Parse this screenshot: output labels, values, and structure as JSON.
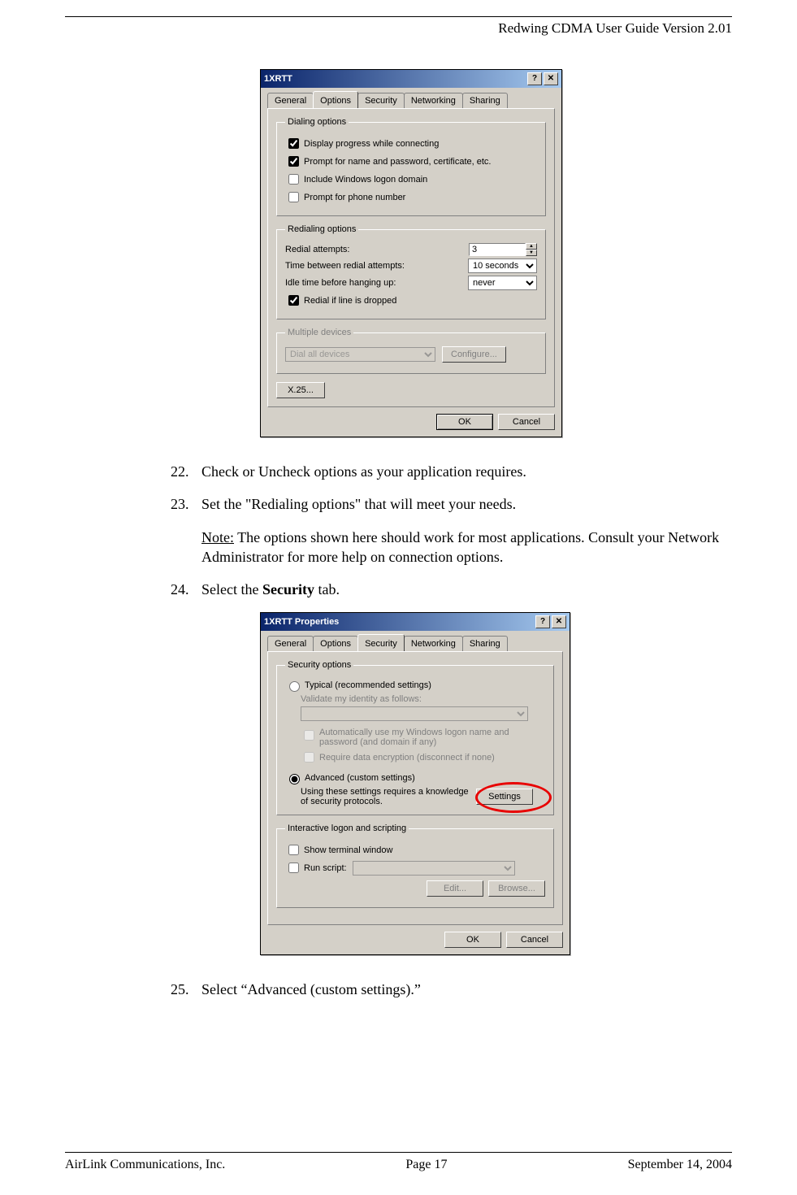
{
  "header": {
    "title": "Redwing CDMA User Guide Version 2.01"
  },
  "dialog1": {
    "title": "1XRTT",
    "help_btn": "?",
    "close_btn": "✕",
    "tabs": [
      "General",
      "Options",
      "Security",
      "Networking",
      "Sharing"
    ],
    "active_tab": 1,
    "dialing_options": {
      "legend": "Dialing options",
      "display_progress": {
        "label": "Display progress while connecting",
        "checked": true
      },
      "prompt_name": {
        "label": "Prompt for name and password, certificate, etc.",
        "checked": true
      },
      "include_domain": {
        "label": "Include Windows logon domain",
        "checked": false
      },
      "prompt_phone": {
        "label": "Prompt for phone number",
        "checked": false
      }
    },
    "redialing_options": {
      "legend": "Redialing options",
      "redial_attempts_label": "Redial attempts:",
      "redial_attempts_value": "3",
      "time_between_label": "Time between redial attempts:",
      "time_between_value": "10 seconds",
      "idle_label": "Idle time before hanging up:",
      "idle_value": "never",
      "redial_dropped": {
        "label": "Redial if line is dropped",
        "checked": true
      }
    },
    "multiple_devices": {
      "legend": "Multiple devices",
      "select_value": "Dial all devices",
      "configure_btn": "Configure..."
    },
    "x25_btn": "X.25...",
    "ok_btn": "OK",
    "cancel_btn": "Cancel"
  },
  "steps": {
    "s22_num": "22.",
    "s22": "Check or Uncheck options as your application requires.",
    "s23_num": "23.",
    "s23": "Set the \"Redialing options\" that will meet your needs.",
    "note_label": "Note:",
    "note_text": " The options shown here should work for most applications. Consult your Network Administrator for more help on connection options.",
    "s24_num": "24.",
    "s24_pre": "Select the ",
    "s24_bold": "Security",
    "s24_post": " tab.",
    "s25_num": "25.",
    "s25": "Select “Advanced (custom settings).”"
  },
  "dialog2": {
    "title": "1XRTT Properties",
    "help_btn": "?",
    "close_btn": "✕",
    "tabs": [
      "General",
      "Options",
      "Security",
      "Networking",
      "Sharing"
    ],
    "active_tab": 2,
    "security_options": {
      "legend": "Security options",
      "typical": {
        "label": "Typical (recommended settings)",
        "selected": false
      },
      "validate_label": "Validate my identity as follows:",
      "auto_logon_label": "Automatically use my Windows logon name and password (and domain if any)",
      "require_encrypt_label": "Require data encryption (disconnect if none)",
      "advanced": {
        "label": "Advanced (custom settings)",
        "selected": true
      },
      "advanced_desc": "Using these settings requires a knowledge of security protocols.",
      "settings_btn": "Settings"
    },
    "interactive": {
      "legend": "Interactive logon and scripting",
      "show_terminal": {
        "label": "Show terminal window",
        "checked": false
      },
      "run_script": {
        "label": "Run script:",
        "checked": false
      },
      "edit_btn": "Edit...",
      "browse_btn": "Browse..."
    },
    "ok_btn": "OK",
    "cancel_btn": "Cancel"
  },
  "footer": {
    "left": "AirLink Communications, Inc.",
    "center": "Page 17",
    "right": "September 14, 2004"
  }
}
